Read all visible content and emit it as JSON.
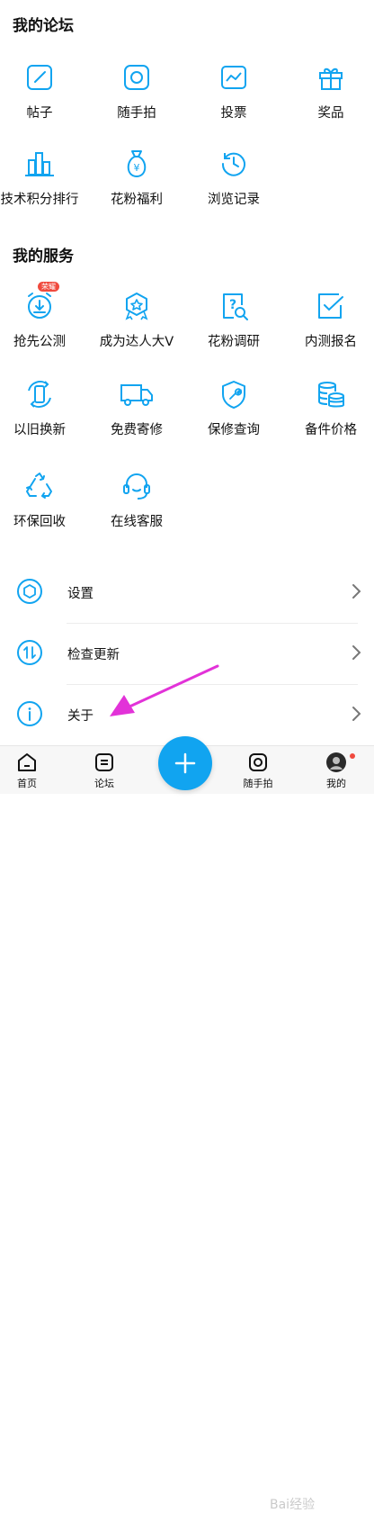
{
  "colors": {
    "accent": "#11a4f0",
    "badge": "#f04a3e",
    "arrow": "#e232d8"
  },
  "forum": {
    "title": "我的论坛",
    "items": [
      {
        "label": "帖子",
        "icon": "edit-post-icon"
      },
      {
        "label": "随手拍",
        "icon": "camera-icon"
      },
      {
        "label": "投票",
        "icon": "vote-chart-icon"
      },
      {
        "label": "奖品",
        "icon": "gift-icon"
      },
      {
        "label": "技术积分排行",
        "icon": "ranking-bars-icon"
      },
      {
        "label": "花粉福利",
        "icon": "money-bag-icon"
      },
      {
        "label": "浏览记录",
        "icon": "history-icon"
      }
    ]
  },
  "services": {
    "title": "我的服务",
    "items": [
      {
        "label": "抢先公测",
        "icon": "download-alarm-icon",
        "badge": "荣耀"
      },
      {
        "label": "成为达人大V",
        "icon": "medal-icon"
      },
      {
        "label": "花粉调研",
        "icon": "survey-search-icon"
      },
      {
        "label": "内测报名",
        "icon": "checkbox-icon"
      },
      {
        "label": "以旧换新",
        "icon": "phone-trade-icon"
      },
      {
        "label": "免费寄修",
        "icon": "truck-icon"
      },
      {
        "label": "保修查询",
        "icon": "shield-wrench-icon"
      },
      {
        "label": "备件价格",
        "icon": "coins-icon"
      },
      {
        "label": "环保回收",
        "icon": "recycle-icon"
      },
      {
        "label": "在线客服",
        "icon": "headset-icon"
      }
    ]
  },
  "settings_list": [
    {
      "label": "设置",
      "icon": "hexagon-settings-icon"
    },
    {
      "label": "检查更新",
      "icon": "update-arrows-icon"
    },
    {
      "label": "关于",
      "icon": "info-icon"
    }
  ],
  "bottom_nav": [
    {
      "label": "首页",
      "icon": "home-icon"
    },
    {
      "label": "论坛",
      "icon": "forum-icon"
    },
    {
      "label": "随手拍",
      "icon": "camera-icon"
    },
    {
      "label": "我的",
      "icon": "profile-avatar-icon"
    }
  ],
  "fab": {
    "icon": "plus-icon"
  },
  "watermark": "Bai经验"
}
